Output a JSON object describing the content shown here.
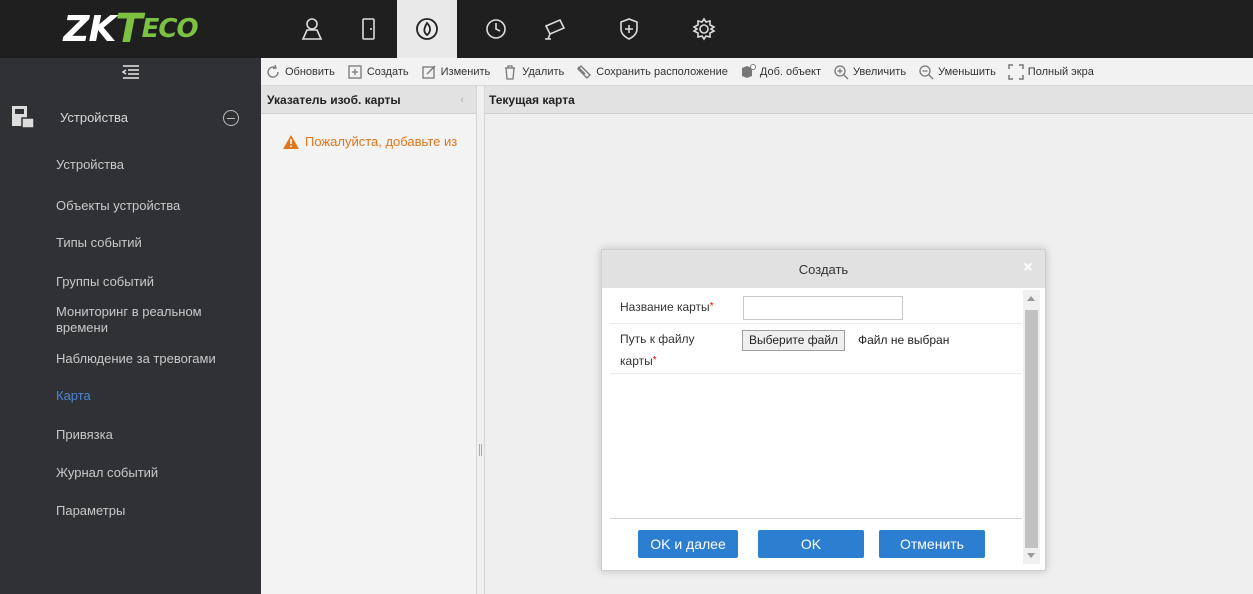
{
  "brand": {
    "zk": "ZK",
    "t": "T",
    "eco": "ECO"
  },
  "modules": [
    {
      "icon": "person-icon"
    },
    {
      "icon": "door-icon"
    },
    {
      "icon": "fire-target-icon",
      "active": true
    },
    {
      "icon": "clock-icon"
    },
    {
      "icon": "camera-icon"
    },
    {
      "icon": "shield-icon"
    },
    {
      "icon": "gear-icon"
    }
  ],
  "toolbar": {
    "refresh": "Обновить",
    "create": "Создать",
    "edit": "Изменить",
    "delete": "Удалить",
    "save_layout": "Сохранить расположение",
    "add_object": "Доб. объект",
    "zoom_in": "Увеличить",
    "zoom_out": "Уменьшить",
    "fullscreen": "Полный экра"
  },
  "sidebar": {
    "section": "Устройства",
    "items": [
      "Устройства",
      "Объекты устройства",
      "Типы событий",
      "Группы событий",
      "Мониторинг в реальном времени",
      "Наблюдение за тревогами",
      "Карта",
      "Привязка",
      "Журнал событий",
      "Параметры"
    ],
    "active": "Карта"
  },
  "left_panel": {
    "title": "Указатель изоб. карты",
    "warning": "Пожалуйста, добавьте из"
  },
  "right_panel": {
    "title": "Текущая карта"
  },
  "modal": {
    "title": "Создать",
    "close": "×",
    "map_name_label": "Название карты",
    "map_path_label_1": "Путь к файлу",
    "map_path_label_2": "карты",
    "required_mark": "*",
    "choose_file": "Выберите файл",
    "no_file": "Файл не выбран",
    "ok_next": "OK и далее",
    "ok": "OK",
    "cancel": "Отменить"
  },
  "colors": {
    "accent": "#2c7fd0",
    "sidebar_bg": "#2f3135",
    "warning": "#e0771b",
    "active_item": "#4a86d6"
  }
}
